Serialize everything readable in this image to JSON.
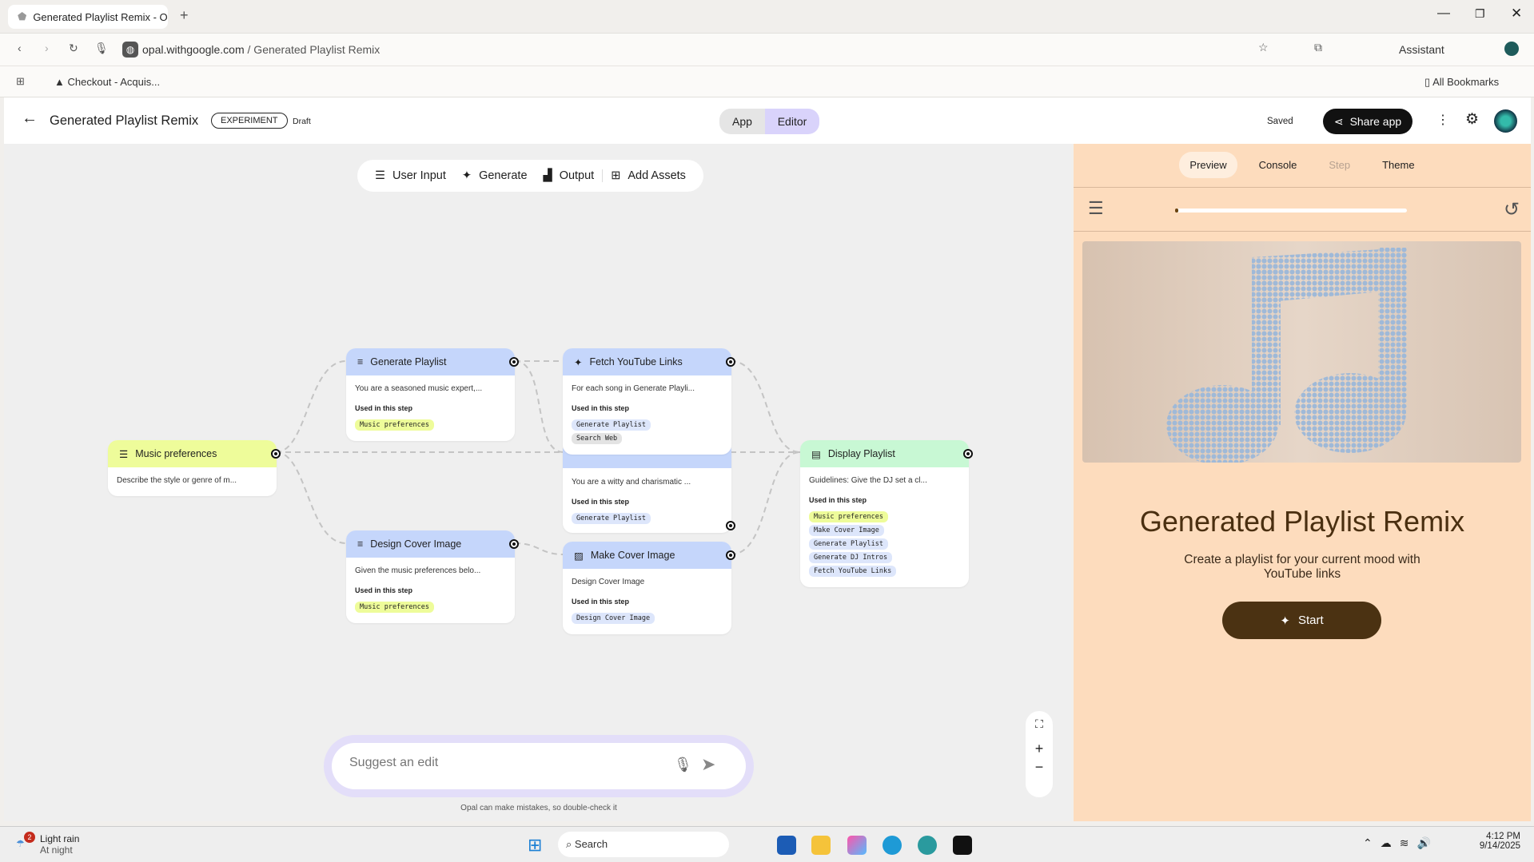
{
  "browser": {
    "tab_title": "Generated Playlist Remix - Op",
    "url_domain": "opal.withgoogle.com",
    "url_path": " / Generated Playlist Remix",
    "bookmark": "Checkout - Acquis...",
    "all_bookmarks": "All Bookmarks",
    "assistant": "Assistant"
  },
  "header": {
    "title": "Generated Playlist Remix",
    "badge": "EXPERIMENT",
    "status": "Draft",
    "mode_app": "App",
    "mode_editor": "Editor",
    "saved": "Saved",
    "share": "Share app"
  },
  "toolbar": {
    "user_input": "User Input",
    "generate": "Generate",
    "output": "Output",
    "add_assets": "Add Assets"
  },
  "used_label": "Used in this step",
  "nodes": {
    "music": {
      "title": "Music preferences",
      "desc": "Describe the style or genre of m..."
    },
    "gen_playlist": {
      "title": "Generate Playlist",
      "desc": "You are a seasoned music expert,...",
      "chips": [
        "Music preferences"
      ]
    },
    "fetch": {
      "title": "Fetch YouTube Links",
      "desc": "For each song in Generate Playli...",
      "chips": [
        "Generate Playlist",
        "Search Web"
      ]
    },
    "dj": {
      "desc": "You are a witty and charismatic ...",
      "chips": [
        "Generate Playlist"
      ]
    },
    "design": {
      "title": "Design Cover Image",
      "desc": "Given the music preferences belo...",
      "chips": [
        "Music preferences"
      ]
    },
    "make": {
      "title": "Make Cover Image",
      "desc": "Design Cover Image",
      "chips": [
        "Design Cover Image"
      ]
    },
    "display": {
      "title": "Display Playlist",
      "desc": "Guidelines: Give the DJ set a cl...",
      "chips": [
        "Music preferences",
        "Make Cover Image",
        "Generate Playlist",
        "Generate DJ Intros",
        "Fetch YouTube Links"
      ]
    }
  },
  "suggest": {
    "placeholder": "Suggest an edit",
    "disclaimer": "Opal can make mistakes, so double-check it"
  },
  "preview": {
    "tabs": [
      "Preview",
      "Console",
      "Step",
      "Theme"
    ],
    "progress": 0.0,
    "title": "Generated Playlist Remix",
    "subtitle": "Create a playlist for your current mood with YouTube links",
    "start": "Start"
  },
  "taskbar": {
    "weather": "Light rain",
    "weather_sub": "At night",
    "weather_badge": "2",
    "search": "Search",
    "time": "4:12 PM",
    "date": "9/14/2025"
  }
}
